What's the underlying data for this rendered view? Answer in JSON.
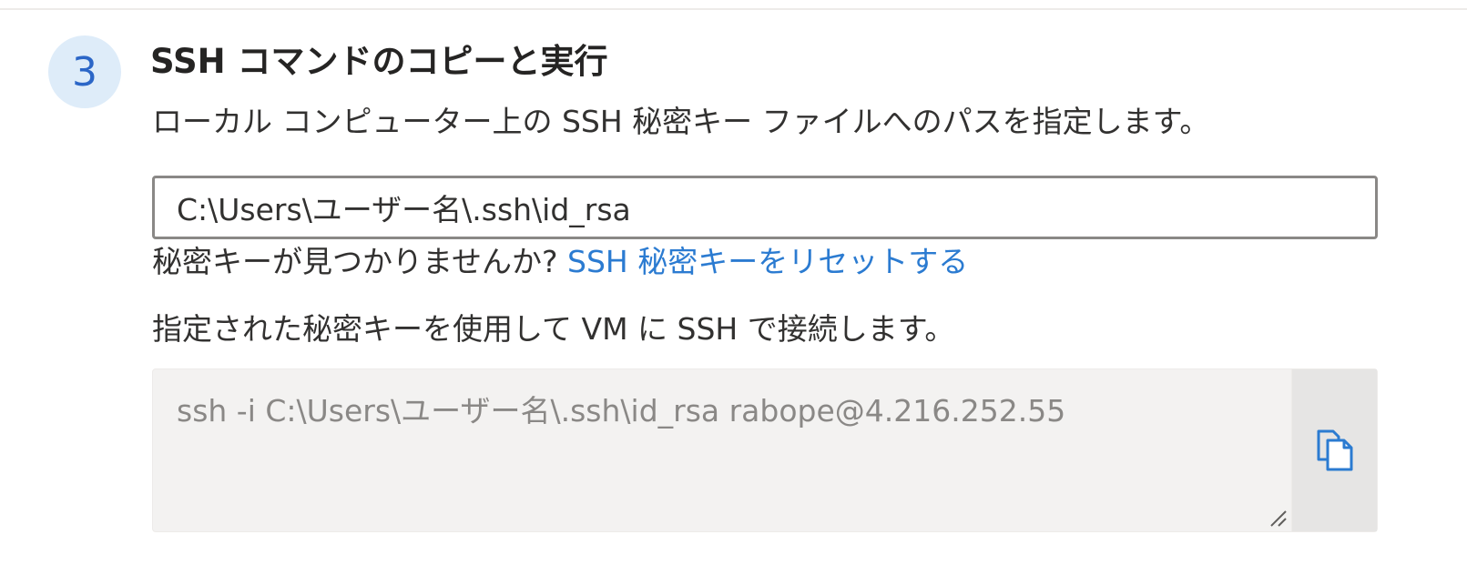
{
  "step": {
    "number": "3",
    "title": "SSH コマンドのコピーと実行",
    "description": "ローカル コンピューター上の SSH 秘密キー ファイルへのパスを指定します。"
  },
  "key_path_input": {
    "value": "C:\\Users\\ユーザー名\\.ssh\\id_rsa"
  },
  "key_help": {
    "prefix": "秘密キーが見つかりませんか? ",
    "link_label": "SSH 秘密キーをリセットする"
  },
  "connect": {
    "description": "指定された秘密キーを使用して VM に SSH で接続します。",
    "command": "ssh -i C:\\Users\\ユーザー名\\.ssh\\id_rsa rabope@4.216.252.55"
  },
  "icons": {
    "copy": "copy-icon",
    "resize": "resize-grip-icon"
  },
  "colors": {
    "accent": "#2b7bd1",
    "badge_bg": "#deecf9",
    "badge_text": "#2b66c7",
    "command_bg": "#f3f2f1"
  }
}
